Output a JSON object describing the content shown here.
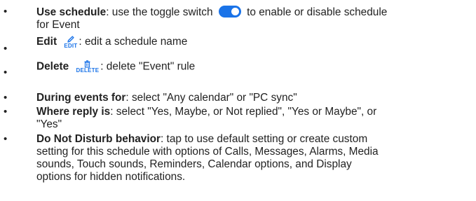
{
  "bullet": "•",
  "accent": "#1a73e8",
  "icons": {
    "toggle": "toggle-switch-icon",
    "edit": "pencil-icon",
    "delete": "trash-icon"
  },
  "items": [
    {
      "term": "Use schedule",
      "pre": ": use the toggle switch",
      "post": "to enable or disable schedule",
      "line2": "for Event"
    },
    {
      "term": "Edit",
      "icon_caption": "EDIT",
      "desc": ": edit a schedule name"
    },
    {
      "term": "Delete",
      "icon_caption": "DELETE",
      "desc": ": delete \"Event\" rule"
    },
    {
      "term": "During events for",
      "desc": ": select \"Any calendar\" or \"PC sync\""
    },
    {
      "term": "Where reply is",
      "desc": ": select \"Yes, Maybe, or Not replied\", \"Yes or Maybe\", or",
      "line2": "\"Yes\""
    },
    {
      "term": "Do Not Disturb behavior",
      "desc": ": tap to use default setting or create custom",
      "line2": "setting for this schedule with options of Calls, Messages, Alarms, Media",
      "line3": "sounds, Touch sounds, Reminders, Calendar options, and Display",
      "line4": "options for hidden notifications."
    }
  ]
}
